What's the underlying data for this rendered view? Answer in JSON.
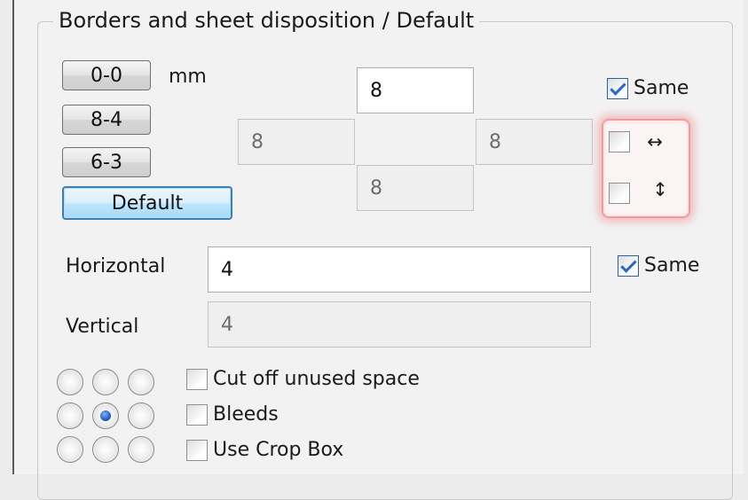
{
  "group": {
    "title": "Borders and sheet disposition / Default"
  },
  "presets": {
    "units": "mm",
    "buttons": [
      "0-0",
      "8-4",
      "6-3",
      "Default"
    ]
  },
  "margins": {
    "top": "8",
    "left": "8",
    "right": "8",
    "bottom": "8",
    "same_label": "Same",
    "same_checked": true
  },
  "mirror": {
    "horizontal_icon": "left-right-arrow-icon",
    "vertical_icon": "up-down-arrow-icon",
    "horizontal_glyph": "↔",
    "vertical_glyph": "↕",
    "horizontal_checked": false,
    "vertical_checked": false
  },
  "spacing": {
    "horizontal_label": "Horizontal",
    "horizontal_value": "4",
    "vertical_label": "Vertical",
    "vertical_value": "4",
    "same_label": "Same",
    "same_checked": true
  },
  "alignment": {
    "selected_index": 4
  },
  "options": [
    {
      "label": "Cut off unused space",
      "checked": false
    },
    {
      "label": "Bleeds",
      "checked": false
    },
    {
      "label": "Use Crop Box",
      "checked": false
    }
  ],
  "colors": {
    "highlight": "#e05a5a",
    "checkmark": "#2b66c5",
    "default_button_border": "#3c7fb1"
  }
}
